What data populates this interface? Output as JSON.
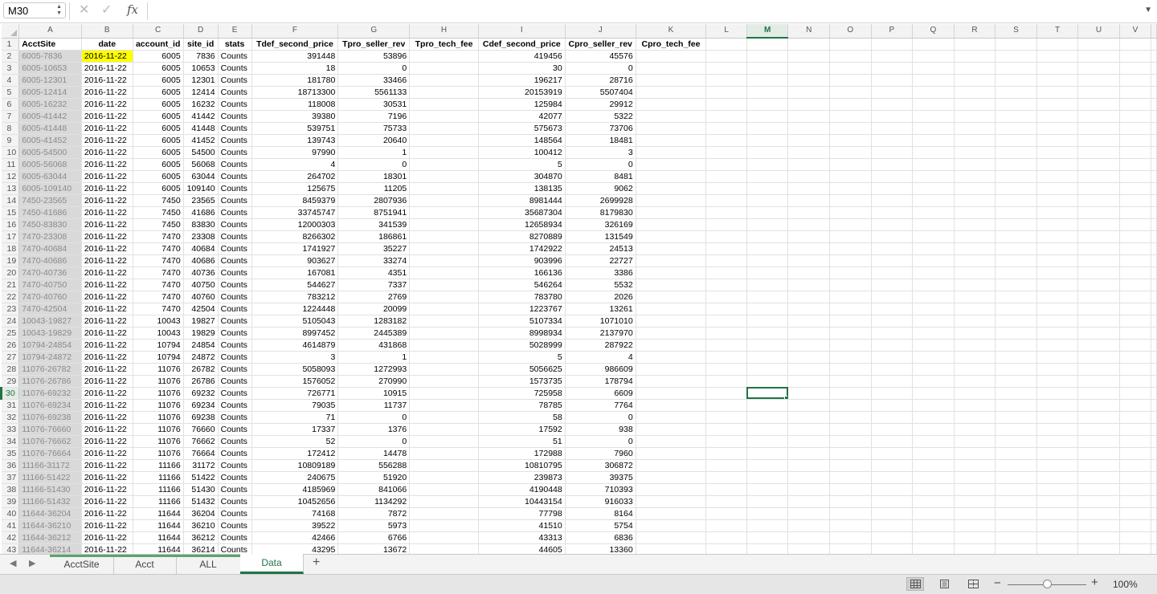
{
  "namebox": "M30",
  "formula": "",
  "columns": [
    "A",
    "B",
    "C",
    "D",
    "E",
    "F",
    "G",
    "H",
    "I",
    "J",
    "K",
    "L",
    "M",
    "N",
    "O",
    "P",
    "Q",
    "R",
    "S",
    "T",
    "U",
    "V"
  ],
  "selected_col": "M",
  "selected_row": 30,
  "headers": [
    "AcctSite",
    "date",
    "account_id",
    "site_id",
    "stats",
    "Tdef_second_price",
    "Tpro_seller_rev",
    "Tpro_tech_fee",
    "Cdef_second_price",
    "Cpro_seller_rev",
    "Cpro_tech_fee"
  ],
  "rows": [
    [
      "6005-7836",
      "2016-11-22",
      "6005",
      "7836",
      "Counts",
      "391448",
      "53896",
      "",
      "419456",
      "45576",
      ""
    ],
    [
      "6005-10653",
      "2016-11-22",
      "6005",
      "10653",
      "Counts",
      "18",
      "0",
      "",
      "30",
      "0",
      ""
    ],
    [
      "6005-12301",
      "2016-11-22",
      "6005",
      "12301",
      "Counts",
      "181780",
      "33466",
      "",
      "196217",
      "28716",
      ""
    ],
    [
      "6005-12414",
      "2016-11-22",
      "6005",
      "12414",
      "Counts",
      "18713300",
      "5561133",
      "",
      "20153919",
      "5507404",
      ""
    ],
    [
      "6005-16232",
      "2016-11-22",
      "6005",
      "16232",
      "Counts",
      "118008",
      "30531",
      "",
      "125984",
      "29912",
      ""
    ],
    [
      "6005-41442",
      "2016-11-22",
      "6005",
      "41442",
      "Counts",
      "39380",
      "7196",
      "",
      "42077",
      "5322",
      ""
    ],
    [
      "6005-41448",
      "2016-11-22",
      "6005",
      "41448",
      "Counts",
      "539751",
      "75733",
      "",
      "575673",
      "73706",
      ""
    ],
    [
      "6005-41452",
      "2016-11-22",
      "6005",
      "41452",
      "Counts",
      "139743",
      "20640",
      "",
      "148564",
      "18481",
      ""
    ],
    [
      "6005-54500",
      "2016-11-22",
      "6005",
      "54500",
      "Counts",
      "97990",
      "1",
      "",
      "100412",
      "3",
      ""
    ],
    [
      "6005-56068",
      "2016-11-22",
      "6005",
      "56068",
      "Counts",
      "4",
      "0",
      "",
      "5",
      "0",
      ""
    ],
    [
      "6005-63044",
      "2016-11-22",
      "6005",
      "63044",
      "Counts",
      "264702",
      "18301",
      "",
      "304870",
      "8481",
      ""
    ],
    [
      "6005-109140",
      "2016-11-22",
      "6005",
      "109140",
      "Counts",
      "125675",
      "11205",
      "",
      "138135",
      "9062",
      ""
    ],
    [
      "7450-23565",
      "2016-11-22",
      "7450",
      "23565",
      "Counts",
      "8459379",
      "2807936",
      "",
      "8981444",
      "2699928",
      ""
    ],
    [
      "7450-41686",
      "2016-11-22",
      "7450",
      "41686",
      "Counts",
      "33745747",
      "8751941",
      "",
      "35687304",
      "8179830",
      ""
    ],
    [
      "7450-83830",
      "2016-11-22",
      "7450",
      "83830",
      "Counts",
      "12000303",
      "341539",
      "",
      "12658934",
      "326169",
      ""
    ],
    [
      "7470-23308",
      "2016-11-22",
      "7470",
      "23308",
      "Counts",
      "8266302",
      "186861",
      "",
      "8270889",
      "131549",
      ""
    ],
    [
      "7470-40684",
      "2016-11-22",
      "7470",
      "40684",
      "Counts",
      "1741927",
      "35227",
      "",
      "1742922",
      "24513",
      ""
    ],
    [
      "7470-40686",
      "2016-11-22",
      "7470",
      "40686",
      "Counts",
      "903627",
      "33274",
      "",
      "903996",
      "22727",
      ""
    ],
    [
      "7470-40736",
      "2016-11-22",
      "7470",
      "40736",
      "Counts",
      "167081",
      "4351",
      "",
      "166136",
      "3386",
      ""
    ],
    [
      "7470-40750",
      "2016-11-22",
      "7470",
      "40750",
      "Counts",
      "544627",
      "7337",
      "",
      "546264",
      "5532",
      ""
    ],
    [
      "7470-40760",
      "2016-11-22",
      "7470",
      "40760",
      "Counts",
      "783212",
      "2769",
      "",
      "783780",
      "2026",
      ""
    ],
    [
      "7470-42504",
      "2016-11-22",
      "7470",
      "42504",
      "Counts",
      "1224448",
      "20099",
      "",
      "1223767",
      "13261",
      ""
    ],
    [
      "10043-19827",
      "2016-11-22",
      "10043",
      "19827",
      "Counts",
      "5105043",
      "1283182",
      "",
      "5107334",
      "1071010",
      ""
    ],
    [
      "10043-19829",
      "2016-11-22",
      "10043",
      "19829",
      "Counts",
      "8997452",
      "2445389",
      "",
      "8998934",
      "2137970",
      ""
    ],
    [
      "10794-24854",
      "2016-11-22",
      "10794",
      "24854",
      "Counts",
      "4614879",
      "431868",
      "",
      "5028999",
      "287922",
      ""
    ],
    [
      "10794-24872",
      "2016-11-22",
      "10794",
      "24872",
      "Counts",
      "3",
      "1",
      "",
      "5",
      "4",
      ""
    ],
    [
      "11076-26782",
      "2016-11-22",
      "11076",
      "26782",
      "Counts",
      "5058093",
      "1272993",
      "",
      "5056625",
      "986609",
      ""
    ],
    [
      "11076-26786",
      "2016-11-22",
      "11076",
      "26786",
      "Counts",
      "1576052",
      "270990",
      "",
      "1573735",
      "178794",
      ""
    ],
    [
      "11076-69232",
      "2016-11-22",
      "11076",
      "69232",
      "Counts",
      "726771",
      "10915",
      "",
      "725958",
      "6609",
      ""
    ],
    [
      "11076-69234",
      "2016-11-22",
      "11076",
      "69234",
      "Counts",
      "79035",
      "11737",
      "",
      "78785",
      "7764",
      ""
    ],
    [
      "11076-69238",
      "2016-11-22",
      "11076",
      "69238",
      "Counts",
      "71",
      "0",
      "",
      "58",
      "0",
      ""
    ],
    [
      "11076-76660",
      "2016-11-22",
      "11076",
      "76660",
      "Counts",
      "17337",
      "1376",
      "",
      "17592",
      "938",
      ""
    ],
    [
      "11076-76662",
      "2016-11-22",
      "11076",
      "76662",
      "Counts",
      "52",
      "0",
      "",
      "51",
      "0",
      ""
    ],
    [
      "11076-76664",
      "2016-11-22",
      "11076",
      "76664",
      "Counts",
      "172412",
      "14478",
      "",
      "172988",
      "7960",
      ""
    ],
    [
      "11166-31172",
      "2016-11-22",
      "11166",
      "31172",
      "Counts",
      "10809189",
      "556288",
      "",
      "10810795",
      "306872",
      ""
    ],
    [
      "11166-51422",
      "2016-11-22",
      "11166",
      "51422",
      "Counts",
      "240675",
      "51920",
      "",
      "239873",
      "39375",
      ""
    ],
    [
      "11166-51430",
      "2016-11-22",
      "11166",
      "51430",
      "Counts",
      "4185969",
      "841066",
      "",
      "4190448",
      "710393",
      ""
    ],
    [
      "11166-51432",
      "2016-11-22",
      "11166",
      "51432",
      "Counts",
      "10452656",
      "1134292",
      "",
      "10443154",
      "916033",
      ""
    ],
    [
      "11644-36204",
      "2016-11-22",
      "11644",
      "36204",
      "Counts",
      "74168",
      "7872",
      "",
      "77798",
      "8164",
      ""
    ],
    [
      "11644-36210",
      "2016-11-22",
      "11644",
      "36210",
      "Counts",
      "39522",
      "5973",
      "",
      "41510",
      "5754",
      ""
    ],
    [
      "11644-36212",
      "2016-11-22",
      "11644",
      "36212",
      "Counts",
      "42466",
      "6766",
      "",
      "43313",
      "6836",
      ""
    ],
    [
      "11644-36214",
      "2016-11-22",
      "11644",
      "36214",
      "Counts",
      "43295",
      "13672",
      "",
      "44605",
      "13360",
      ""
    ]
  ],
  "tabs": [
    {
      "label": "AcctSite",
      "active": false
    },
    {
      "label": "Acct",
      "active": false
    },
    {
      "label": "ALL",
      "active": false
    },
    {
      "label": "Data",
      "active": true
    }
  ],
  "add_tab": "+",
  "zoom_minus": "−",
  "zoom_plus": "+",
  "zoom_label": "100%",
  "zoom_level": 1.0,
  "colors": {
    "accent": "#217346",
    "highlight": "#ffff00",
    "acct_bg": "#d9d9d9"
  },
  "icons": [
    "cancel-icon",
    "confirm-icon",
    "function-icon",
    "normal-view-icon",
    "page-layout-icon",
    "page-break-icon"
  ]
}
